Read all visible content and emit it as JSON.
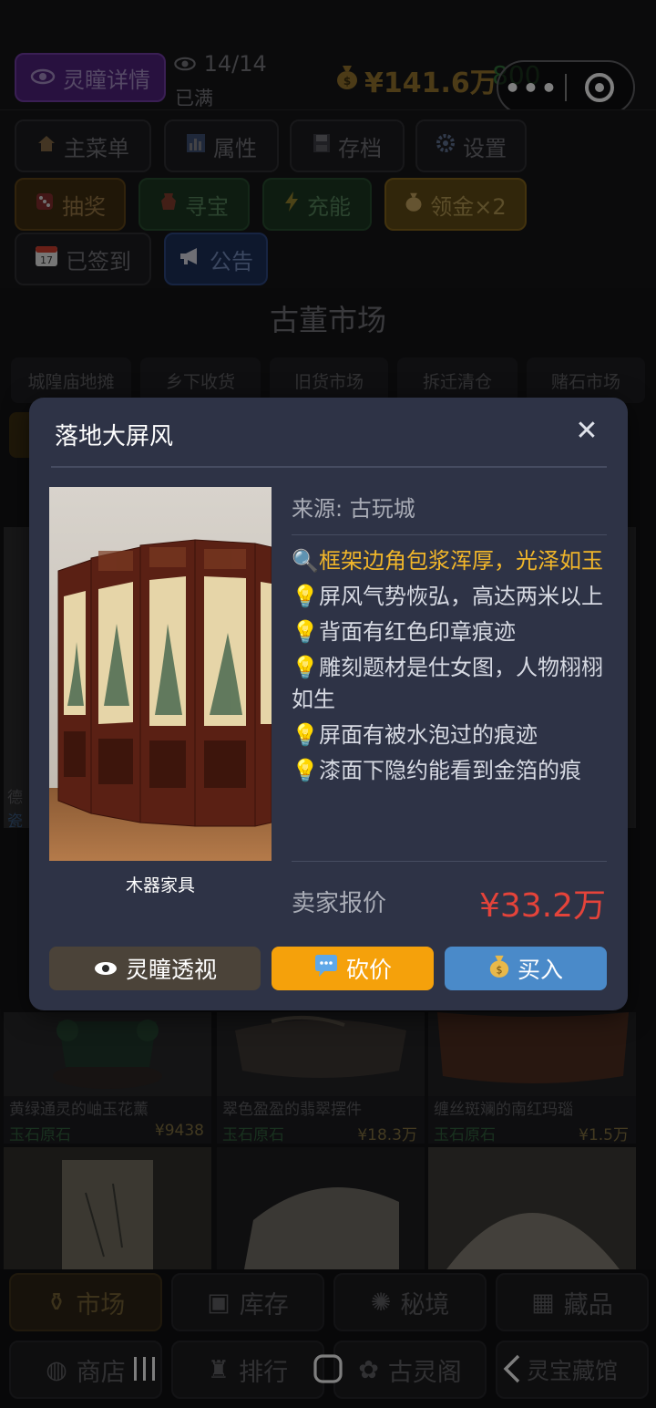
{
  "header": {
    "eye_button": "灵瞳详情",
    "eye_count": "14/14",
    "eye_status": "已满",
    "money": "¥141.6万",
    "energy": "800"
  },
  "menu": {
    "main_menu": "主菜单",
    "attributes": "属性",
    "save": "存档",
    "settings": "设置",
    "lottery": "抽奖",
    "treasure": "寻宝",
    "charge": "充能",
    "claim_gold": "领金×2",
    "signed_in": "已签到",
    "calendar_day": "17",
    "announcement": "公告"
  },
  "market": {
    "title": "古董市场",
    "tabs": [
      "城隍庙地摊",
      "乡下收货",
      "旧货市场",
      "拆迁清仓",
      "赌石市场"
    ],
    "left_card_fragments": [
      "德",
      "瓷"
    ],
    "cards": [
      {
        "name": "黄绿通灵的岫玉花薰",
        "category": "玉石原石",
        "price": "¥9438"
      },
      {
        "name": "翠色盈盈的翡翠摆件",
        "category": "玉石原石",
        "price": "¥18.3万"
      },
      {
        "name": "缠丝斑斓的南红玛瑙",
        "category": "玉石原石",
        "price": "¥1.5万"
      }
    ]
  },
  "bottom_nav": {
    "row1": [
      "市场",
      "库存",
      "秘境",
      "藏品"
    ],
    "row2": [
      "商店",
      "排行",
      "古灵阁",
      "灵宝藏馆"
    ]
  },
  "modal": {
    "title": "落地大屏风",
    "source": "来源: 古玩城",
    "category": "木器家具",
    "clues": [
      {
        "icon": "magnifier",
        "text": "框架边角包浆浑厚，光泽如玉",
        "highlight": true
      },
      {
        "icon": "bulb",
        "text": "屏风气势恢弘，高达两米以上",
        "highlight": false
      },
      {
        "icon": "bulb",
        "text": "背面有红色印章痕迹",
        "highlight": false
      },
      {
        "icon": "bulb",
        "text": "雕刻题材是仕女图，人物栩栩如生",
        "highlight": false
      },
      {
        "icon": "bulb",
        "text": "屏面有被水泡过的痕迹",
        "highlight": false
      },
      {
        "icon": "bulb",
        "text": "漆面下隐约能看到金箔的痕",
        "highlight": false
      }
    ],
    "offer_label": "卖家报价",
    "offer_price": "¥33.2万",
    "actions": {
      "peek": "灵瞳透视",
      "bargain": "砍价",
      "buy": "买入"
    }
  },
  "colors": {
    "modal_bg": "#2e3346",
    "highlight": "#f1b62a",
    "price": "#e4433a",
    "bargain": "#f5a10b",
    "buy": "#4a8ac9",
    "peek": "#4b4339"
  }
}
